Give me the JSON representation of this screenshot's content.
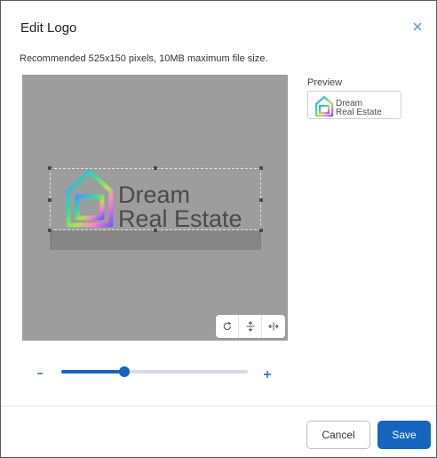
{
  "dialog": {
    "title": "Edit Logo",
    "subtitle": "Recommended 525x150 pixels, 10MB maximum file size.",
    "close_icon": "close-icon"
  },
  "editor": {
    "logo_line1": "Dream",
    "logo_line2": "Real Estate",
    "tools": [
      "rotate-icon",
      "flip-vertical-icon",
      "flip-horizontal-icon"
    ]
  },
  "preview": {
    "label": "Preview",
    "logo_line1": "Dream",
    "logo_line2": "Real Estate"
  },
  "zoom": {
    "minus": "−",
    "plus": "+",
    "value_fraction": 0.34,
    "accent": "#1565c0"
  },
  "actions": {
    "cancel_label": "Cancel",
    "save_label": "Save"
  },
  "colors": {
    "primary": "#1565c0",
    "canvas": "#9d9d9d"
  }
}
